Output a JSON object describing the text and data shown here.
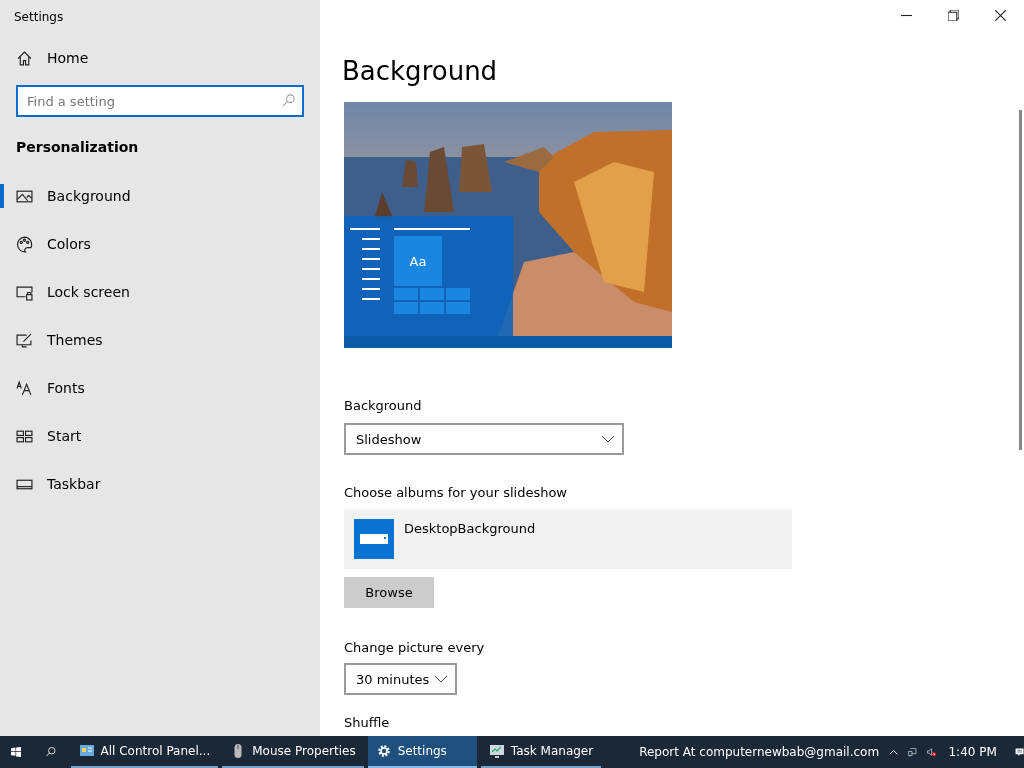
{
  "window": {
    "title": "Settings"
  },
  "sidebar": {
    "home": "Home",
    "search": {
      "placeholder": "Find a setting"
    },
    "section": "Personalization",
    "items": [
      {
        "label": "Background",
        "selected": true
      },
      {
        "label": "Colors",
        "selected": false
      },
      {
        "label": "Lock screen",
        "selected": false
      },
      {
        "label": "Themes",
        "selected": false
      },
      {
        "label": "Fonts",
        "selected": false
      },
      {
        "label": "Start",
        "selected": false
      },
      {
        "label": "Taskbar",
        "selected": false
      }
    ]
  },
  "content": {
    "title": "Background",
    "preview": {
      "tile_text": "Aa"
    },
    "background_label": "Background",
    "background_value": "Slideshow",
    "albums_label": "Choose albums for your slideshow",
    "album": "DesktopBackground",
    "browse": "Browse",
    "interval_label": "Change picture every",
    "interval_value": "30 minutes",
    "shuffle_label": "Shuffle"
  },
  "taskbar": {
    "apps": [
      {
        "label": "All Control Panel...",
        "selected": false
      },
      {
        "label": "Mouse Properties",
        "selected": false
      },
      {
        "label": "Settings",
        "selected": true
      },
      {
        "label": "Task Manager",
        "selected": false
      }
    ],
    "report": "Report At computernewbab@gmail.com",
    "time": "1:40 PM"
  }
}
